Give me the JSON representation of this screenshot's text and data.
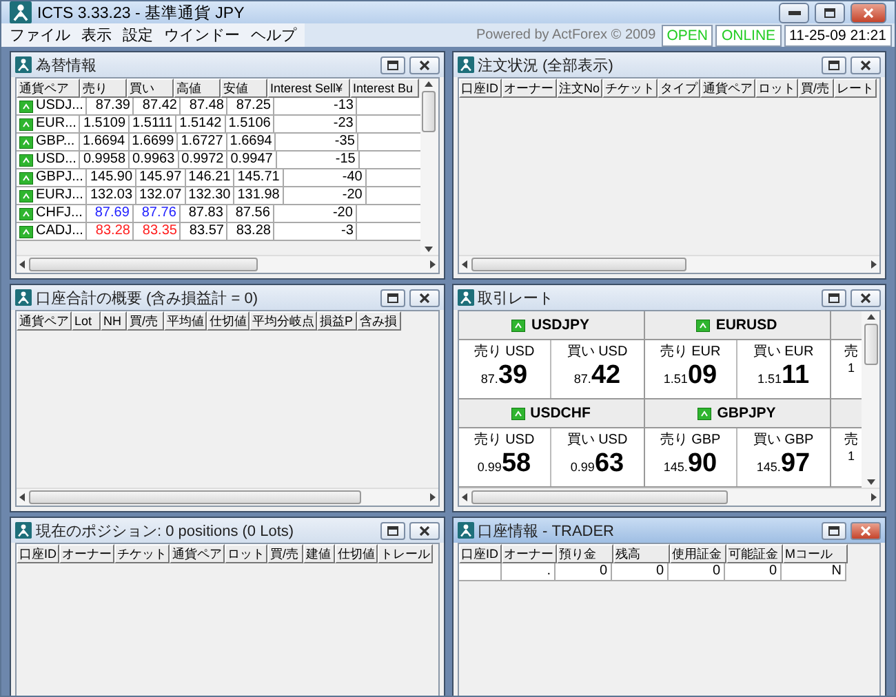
{
  "window": {
    "title": "ICTS 3.33.23 - 基準通貨 JPY"
  },
  "menu": [
    "ファイル",
    "表示",
    "設定",
    "ウインドー",
    "ヘルプ"
  ],
  "status": {
    "powered": "Powered by ActForex © 2009",
    "market": "OPEN",
    "connection": "ONLINE",
    "datetime": "11-25-09 21:21"
  },
  "panels": [
    {
      "kind": "quotes",
      "title": "為替情報",
      "active": false,
      "columns": [
        "通貨ペア",
        "売り",
        "買い",
        "高値",
        "安値",
        "Interest Sell¥",
        "Interest Bu"
      ],
      "rows": [
        {
          "color": "#000000",
          "cells": [
            "USDJ...",
            "87.39",
            "87.42",
            "87.48",
            "87.25",
            "-13",
            ""
          ]
        },
        {
          "color": "#000000",
          "cells": [
            "EUR...",
            "1.5109",
            "1.5111",
            "1.5142",
            "1.5106",
            "-23",
            ""
          ]
        },
        {
          "color": "#000000",
          "cells": [
            "GBP...",
            "1.6694",
            "1.6699",
            "1.6727",
            "1.6694",
            "-35",
            ""
          ]
        },
        {
          "color": "#000000",
          "cells": [
            "USD...",
            "0.9958",
            "0.9963",
            "0.9972",
            "0.9947",
            "-15",
            ""
          ]
        },
        {
          "color": "#000000",
          "cells": [
            "GBPJ...",
            "145.90",
            "145.97",
            "146.21",
            "145.71",
            "-40",
            ""
          ]
        },
        {
          "color": "#000000",
          "cells": [
            "EURJ...",
            "132.03",
            "132.07",
            "132.30",
            "131.98",
            "-20",
            ""
          ]
        },
        {
          "color": "#2222ff",
          "cells": [
            "CHFJ...",
            "87.69",
            "87.76",
            "87.83",
            "87.56",
            "-20",
            ""
          ]
        },
        {
          "color": "#ff2020",
          "cells": [
            "CADJ...",
            "83.28",
            "83.35",
            "83.57",
            "83.28",
            "-3",
            ""
          ]
        }
      ]
    },
    {
      "kind": "table",
      "title": "注文状況 (全部表示)",
      "active": false,
      "columns": [
        "口座ID",
        "オーナー",
        "注文No",
        "チケット",
        "タイプ",
        "通貨ペア",
        "ロット",
        "買/売",
        "レート"
      ]
    },
    {
      "kind": "table",
      "title": "口座合計の概要 (含み損益計 = 0)",
      "active": false,
      "columns": [
        "通貨ペア",
        "Lot",
        "NH",
        "買/売",
        "平均値",
        "仕切値",
        "平均分岐点",
        "損益P",
        "含み損"
      ]
    },
    {
      "kind": "tiles",
      "title": "取引レート",
      "active": false,
      "tiles": [
        {
          "pair": "USDJPY",
          "sell_label": "売り USD",
          "sell_small": "87.",
          "sell_big": "39",
          "buy_label": "買い USD",
          "buy_small": "87.",
          "buy_big": "42"
        },
        {
          "pair": "EURUSD",
          "sell_label": "売り EUR",
          "sell_small": "1.51",
          "sell_big": "09",
          "buy_label": "買い EUR",
          "buy_small": "1.51",
          "buy_big": "11"
        },
        {
          "pair": "USDCHF",
          "sell_label": "売り USD",
          "sell_small": "0.99",
          "sell_big": "58",
          "buy_label": "買い USD",
          "buy_small": "0.99",
          "buy_big": "63"
        },
        {
          "pair": "GBPJPY",
          "sell_label": "売り GBP",
          "sell_small": "145.",
          "sell_big": "90",
          "buy_label": "買い GBP",
          "buy_small": "145.",
          "buy_big": "97"
        }
      ],
      "edges": [
        {
          "label": "売",
          "small": "1"
        },
        {
          "label": "売",
          "small": "1"
        }
      ]
    },
    {
      "kind": "table",
      "title": "現在のポジション: 0 positions (0 Lots)",
      "active": false,
      "columns": [
        "口座ID",
        "オーナー",
        "チケット",
        "通貨ペア",
        "ロット",
        "買/売",
        "建値",
        "仕切値",
        "トレール"
      ]
    },
    {
      "kind": "table",
      "title": "口座情報 - TRADER",
      "active": true,
      "columns": [
        "口座ID",
        "オーナー",
        "預り金",
        "残高",
        "使用証金",
        "可能証金",
        "Mコール"
      ],
      "rows": [
        {
          "cells": [
            "",
            ".",
            "0",
            "0",
            "0",
            "0",
            "N"
          ]
        }
      ]
    }
  ]
}
